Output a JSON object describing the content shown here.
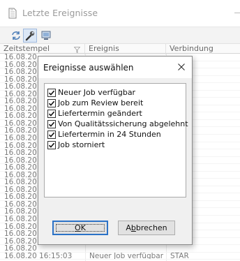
{
  "window": {
    "title": "Letzte Ereignisse",
    "icon": "document-icon"
  },
  "toolbar": {
    "buttons": [
      {
        "name": "refresh-icon"
      },
      {
        "name": "settings-wrench-icon",
        "pressed": true
      },
      {
        "name": "monitor-icon"
      }
    ]
  },
  "grid": {
    "columns": [
      "Zeitstempel",
      "Ereignis",
      "Verbindung"
    ],
    "rows": [
      {
        "time": "16.08.20",
        "event": "",
        "connection": ""
      },
      {
        "time": "16.08.20",
        "event": "",
        "connection": ""
      },
      {
        "time": "16.08.20",
        "event": "",
        "connection": ""
      },
      {
        "time": "16.08.20",
        "event": "",
        "connection": ""
      },
      {
        "time": "16.08.20",
        "event": "",
        "connection": ""
      },
      {
        "time": "16.08.20",
        "event": "",
        "connection": ""
      },
      {
        "time": "16.08.20",
        "event": "",
        "connection": ""
      },
      {
        "time": "16.08.20",
        "event": "",
        "connection": ""
      },
      {
        "time": "16.08.20",
        "event": "",
        "connection": ""
      },
      {
        "time": "16.08.20",
        "event": "",
        "connection": ""
      },
      {
        "time": "16.08.20",
        "event": "",
        "connection": ""
      },
      {
        "time": "16.08.20",
        "event": "",
        "connection": ""
      },
      {
        "time": "16.08.20",
        "event": "",
        "connection": ""
      },
      {
        "time": "16.08.20",
        "event": "",
        "connection": ""
      },
      {
        "time": "16.08.20",
        "event": "",
        "connection": ""
      },
      {
        "time": "16.08.20",
        "event": "",
        "connection": ""
      },
      {
        "time": "16.08.20",
        "event": "",
        "connection": ""
      },
      {
        "time": "16.08.20",
        "event": "",
        "connection": ""
      },
      {
        "time": "16.08.20",
        "event": "",
        "connection": ""
      },
      {
        "time": "16.08.20",
        "event": "",
        "connection": ""
      },
      {
        "time": "16.08.20",
        "event": "",
        "connection": ""
      },
      {
        "time": "16.08.20",
        "event": "",
        "connection": ""
      },
      {
        "time": "16.08.20",
        "event": "",
        "connection": ""
      },
      {
        "time": "16.08.20",
        "event": "",
        "connection": ""
      },
      {
        "time": "16.08.20",
        "event": "",
        "connection": ""
      },
      {
        "time": "16.08.20",
        "event": "",
        "connection": ""
      },
      {
        "time": "16.08.20",
        "event": "",
        "connection": ""
      },
      {
        "time": "16.08.20 16:15:03",
        "event": "Neuer Job verfügbar",
        "connection": "STAR"
      }
    ]
  },
  "dialog": {
    "title": "Ereignisse auswählen",
    "items": [
      {
        "label": "Neuer Job verfügbar",
        "checked": true
      },
      {
        "label": "Job zum Review bereit",
        "checked": true
      },
      {
        "label": "Liefertermin geändert",
        "checked": true
      },
      {
        "label": "Von Qualitätssicherung abgelehnt",
        "checked": true
      },
      {
        "label": "Liefertermin in 24 Stunden",
        "checked": true
      },
      {
        "label": "Job storniert",
        "checked": true
      }
    ],
    "ok": {
      "mnemonic": "O",
      "rest": "K"
    },
    "cancel": {
      "pre": "A",
      "mnemonic": "b",
      "rest": "brechen"
    }
  }
}
